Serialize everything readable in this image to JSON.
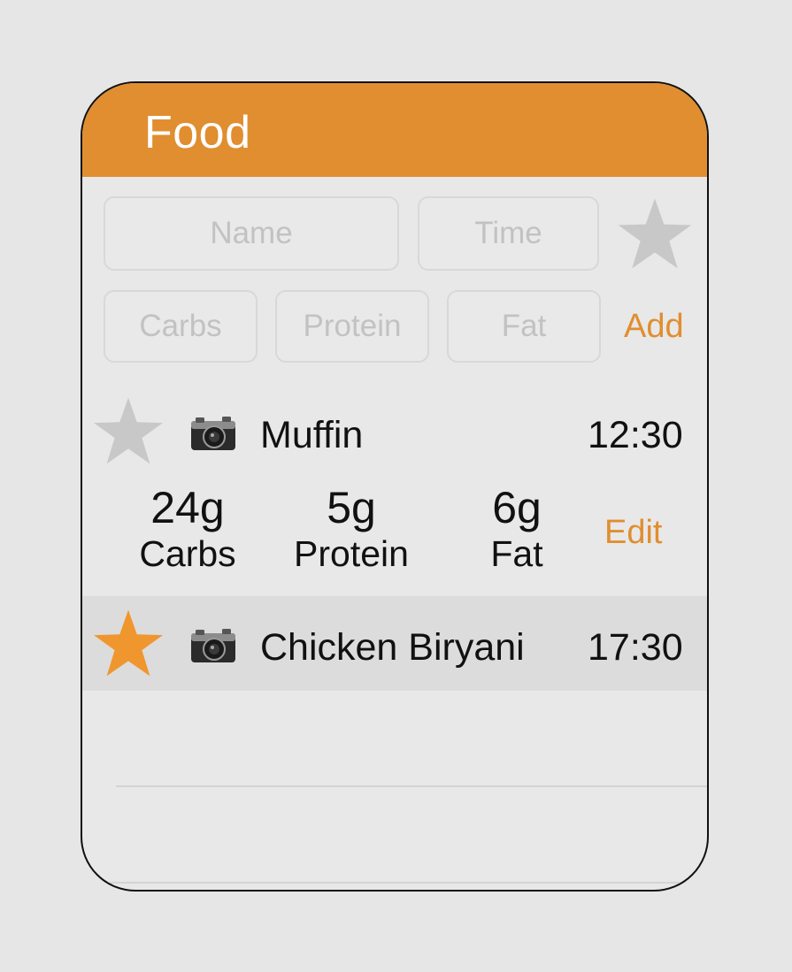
{
  "header": {
    "title": "Food"
  },
  "form": {
    "name_placeholder": "Name",
    "time_placeholder": "Time",
    "carbs_placeholder": "Carbs",
    "protein_placeholder": "Protein",
    "fat_placeholder": "Fat",
    "add_label": "Add",
    "favorite_icon": "star-icon",
    "favorite_color": "#c8c8c8"
  },
  "entries": [
    {
      "name": "Muffin",
      "time": "12:30",
      "favorite": false,
      "star_color": "#c8c8c8",
      "photo_icon": "camera-icon",
      "expanded": true,
      "carbs_value": "24g",
      "carbs_label": "Carbs",
      "protein_value": "5g",
      "protein_label": "Protein",
      "fat_value": "6g",
      "fat_label": "Fat",
      "edit_label": "Edit"
    },
    {
      "name": "Chicken Biryani",
      "time": "17:30",
      "favorite": true,
      "star_color": "#f0962e",
      "photo_icon": "camera-icon",
      "expanded": false
    }
  ],
  "colors": {
    "accent": "#e08e30",
    "background": "#e8e8e8",
    "selected_row": "#dcdcdc"
  }
}
